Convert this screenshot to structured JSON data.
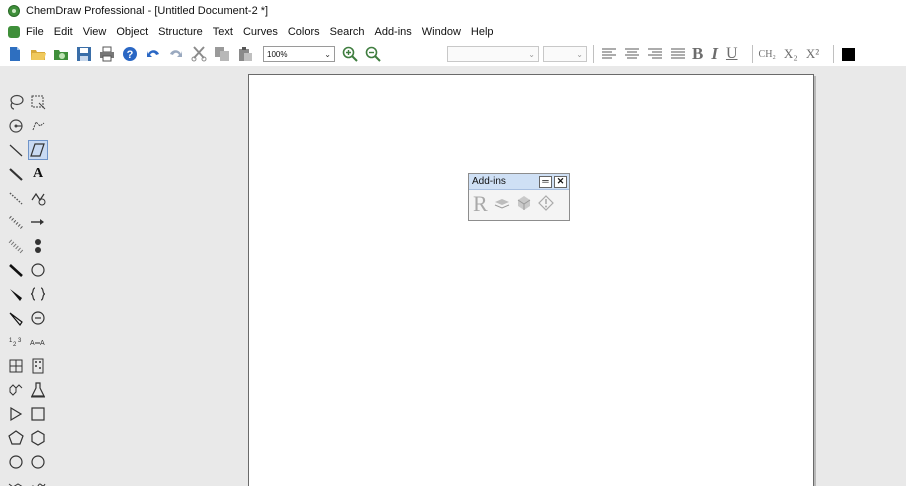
{
  "window": {
    "title": "ChemDraw Professional - [Untitled Document-2 *]"
  },
  "menu": {
    "items": [
      {
        "label": "File"
      },
      {
        "label": "Edit"
      },
      {
        "label": "View"
      },
      {
        "label": "Object"
      },
      {
        "label": "Structure"
      },
      {
        "label": "Text"
      },
      {
        "label": "Curves"
      },
      {
        "label": "Colors"
      },
      {
        "label": "Search"
      },
      {
        "label": "Add-ins"
      },
      {
        "label": "Window"
      },
      {
        "label": "Help"
      }
    ]
  },
  "toolbar": {
    "zoom_value": "100%",
    "zoom_arrow": "⌄",
    "bold_label": "B",
    "italic_label": "I",
    "underline_label": "U",
    "formula_label": "CH₂",
    "subscript_label": "X₂",
    "superscript_label": "X²",
    "icons": [
      "new-document-icon",
      "open-icon",
      "open-template-icon",
      "save-icon",
      "print-icon",
      "help-icon",
      "undo-icon",
      "redo-icon",
      "cut-icon",
      "copy-icon",
      "paste-icon",
      "zoom-in-icon",
      "zoom-out-icon",
      "align-left-icon",
      "align-center-icon",
      "align-right-icon",
      "justify-icon",
      "color-swatch-icon"
    ]
  },
  "palette": {
    "tools": [
      "lasso-icon",
      "marquee-icon",
      "rotate-icon",
      "structure-perspective-icon",
      "single-bond-icon",
      "eraser-icon",
      "bold-bond-icon",
      "text-icon",
      "hashed-bond-icon",
      "chain-icon",
      "hashed-wedge-icon",
      "arrow-icon",
      "wide-hashed-wedge-icon",
      "orbital-icon",
      "solid-bond-icon",
      "circle-icon",
      "wedge-bond-icon",
      "brackets-icon",
      "hollow-wedge-icon",
      "charge-icon",
      "atom-map-icon",
      "reaction-map-icon",
      "table-icon",
      "tlc-plate-icon",
      "template-ring-icon",
      "lab-flask-icon",
      "triangle-icon",
      "square-icon",
      "pentagon-icon",
      "hexagon-icon",
      "circle-ring-icon",
      "octagon-icon",
      "chair-icon",
      "boat-icon"
    ],
    "text_tool_label": "A"
  },
  "addins_palette": {
    "title": "Add-ins",
    "minimize_label": "═",
    "close_label": "✕",
    "r_label": "R",
    "icons": [
      "r-group-icon",
      "layers-icon",
      "grid-icon",
      "warning-icon"
    ]
  },
  "colors": {
    "accent": "#3f8f3a",
    "selection": "#c9daf2",
    "palette_bg": "#e9e9e9"
  }
}
